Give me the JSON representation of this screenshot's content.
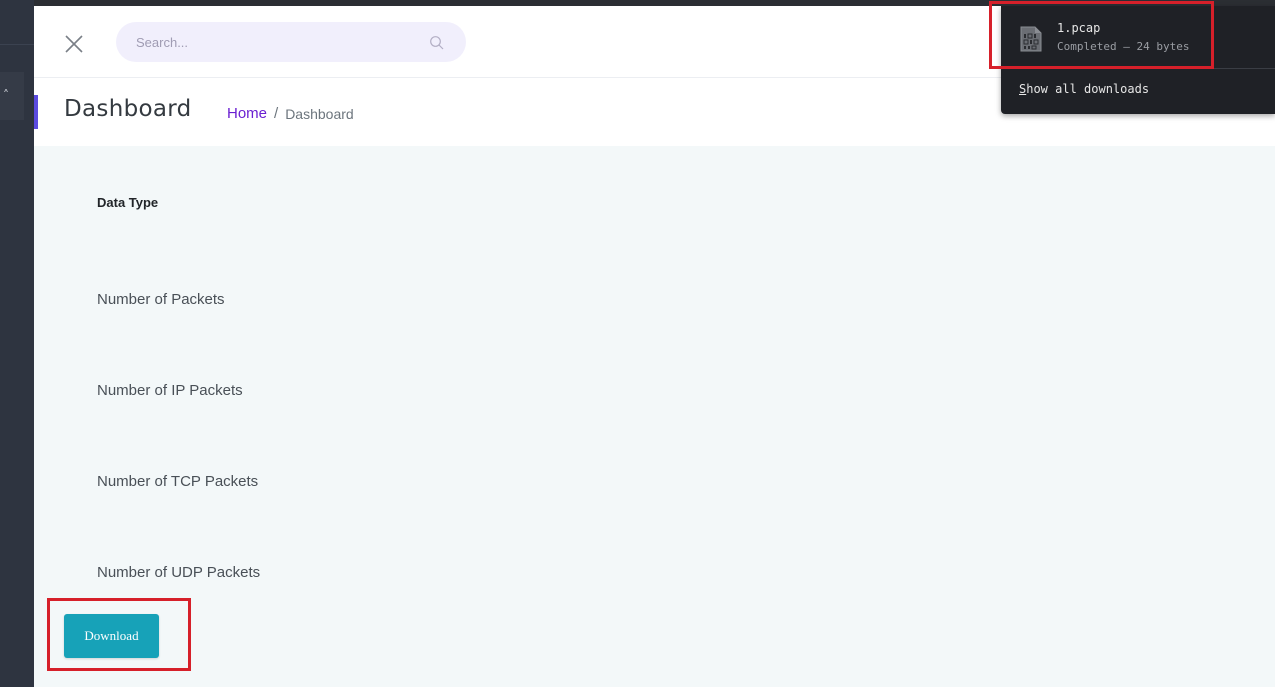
{
  "search": {
    "placeholder": "Search..."
  },
  "icons": {
    "close": "close-icon",
    "search": "search-icon",
    "file": "binary-file-icon",
    "rail_chevron": "chevron-up-icon"
  },
  "header": {
    "title": "Dashboard",
    "breadcrumb": {
      "home": "Home",
      "separator": "/",
      "current": "Dashboard"
    }
  },
  "table": {
    "column_header": "Data Type",
    "rows": [
      "Number of Packets",
      "Number of IP Packets",
      "Number of TCP Packets",
      "Number of UDP Packets"
    ]
  },
  "actions": {
    "download_label": "Download"
  },
  "downloads_panel": {
    "item": {
      "filename": "1.pcap",
      "status": "Completed — 24 bytes"
    },
    "show_all_prefix": "S",
    "show_all_rest": "how all downloads"
  },
  "colors": {
    "accent": "#5b4be0",
    "breadcrumb_link": "#6a1fd1",
    "download_button": "#17a2b8",
    "content_bg": "#f3f8f9",
    "highlight": "#d6202a",
    "panel_bg": "#1f2126"
  }
}
